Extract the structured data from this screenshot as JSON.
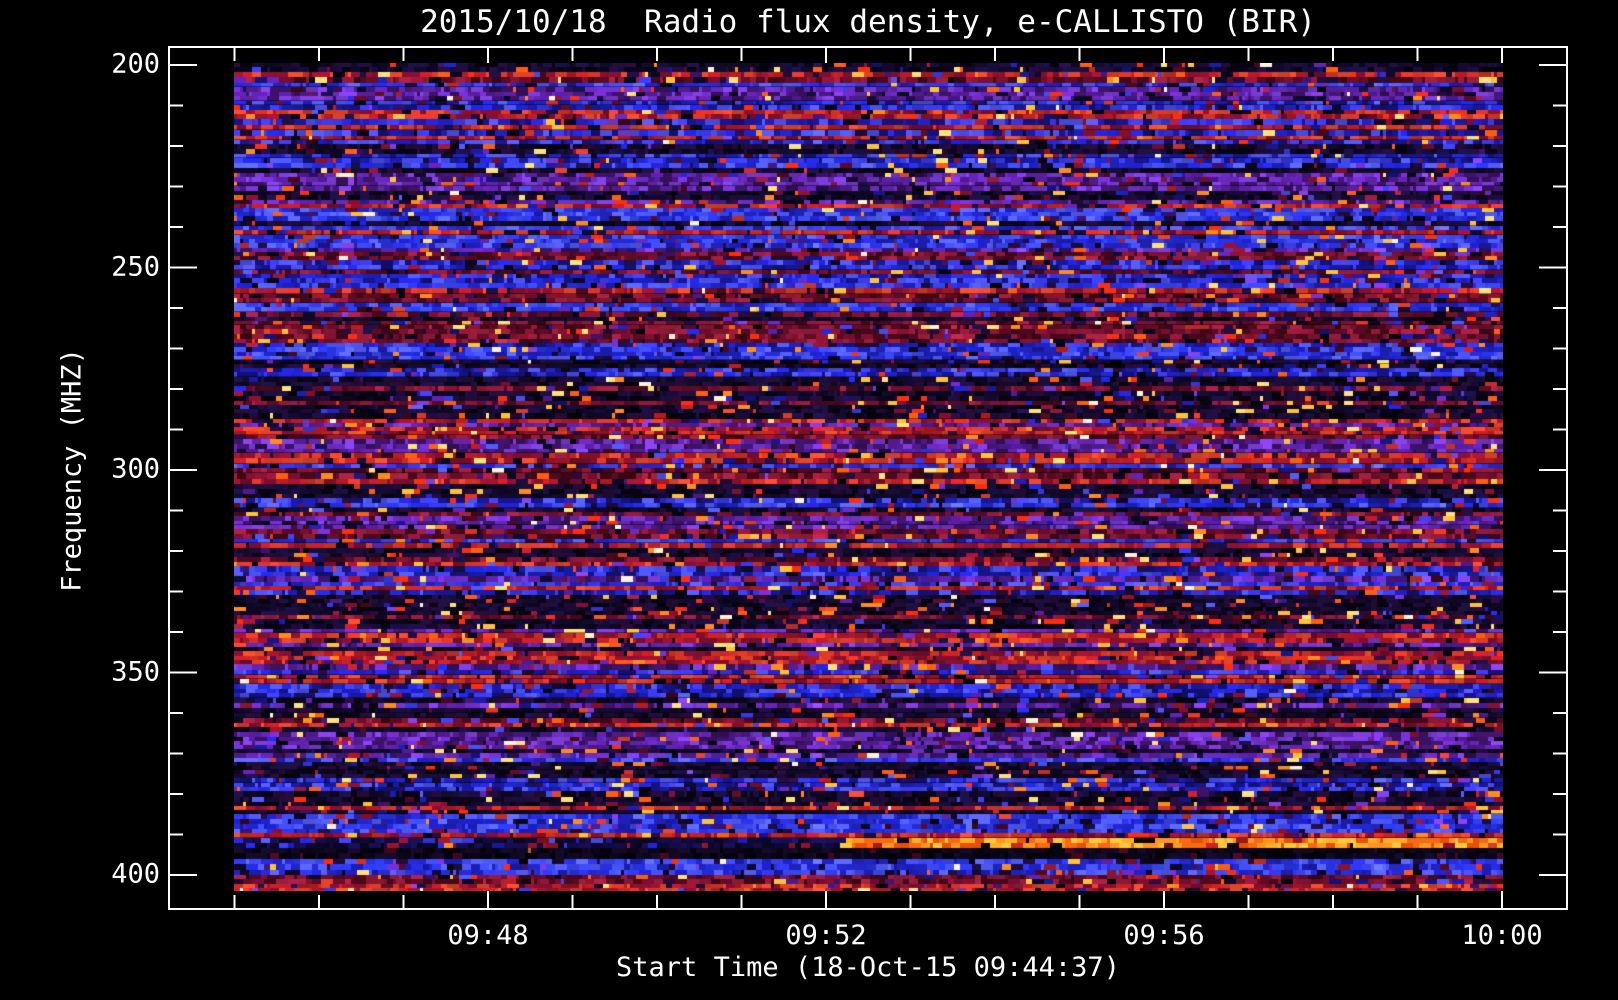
{
  "title": "2015/10/18  Radio flux density, e-CALLISTO (BIR)",
  "axes": {
    "x": {
      "title": "Start Time (18-Oct-15 09:44:37)",
      "major_tick_labels": [
        "09:48",
        "09:52",
        "09:56",
        "10:00"
      ],
      "minor_tick_interval": "1 min"
    },
    "y": {
      "title": "Frequency (MHZ)",
      "major_tick_labels": [
        "200",
        "250",
        "300",
        "350",
        "400"
      ],
      "minor_tick_interval": "10 MHz"
    }
  },
  "chart_data": {
    "type": "heatmap",
    "title": "2015/10/18  Radio flux density, e-CALLISTO (BIR)",
    "xlabel": "Start Time (18-Oct-15 09:44:37)",
    "ylabel": "Frequency (MHZ)",
    "x_ticks": [
      "09:48",
      "09:52",
      "09:56",
      "10:00"
    ],
    "x_range": [
      "09:45:00",
      "10:00:00"
    ],
    "y_ticks": [
      200,
      250,
      300,
      350,
      400
    ],
    "y_range_mhz": [
      199,
      404
    ],
    "y_axis_inverted": true,
    "grid": false,
    "legend": false,
    "content_description": "Dense broadband noise spectrogram: horizontal frequency-channel bands alternating bright blue, purple, red, maroon and near-black, with sparse orange/yellow speckles and vertical striations",
    "features": [
      {
        "name": "quiet-dark-channel",
        "freq_mhz": 392,
        "time_span": [
          "09:45",
          "09:52"
        ],
        "appearance": "dark navy/black horizontal band"
      },
      {
        "name": "rfi-carrier",
        "freq_mhz": 392,
        "time_span": [
          "09:52",
          "10:00"
        ],
        "appearance": "bright orange-yellow horizontal line switching on near 09:52"
      },
      {
        "name": "black-channel",
        "freq_mhz": 395,
        "time_span": [
          "09:45",
          "10:00"
        ],
        "appearance": "near-black horizontal band across full width"
      }
    ],
    "palette": {
      "background": "#000000",
      "axis_and_text": "#ffffff",
      "blue": [
        "#2126d8",
        "#3a3cf0",
        "#1a1aa8",
        "#4d55f5",
        "#14127a"
      ],
      "bright_blue": [
        "#2b35f0",
        "#3f4cff",
        "#2226c8",
        "#5560ff",
        "#1c1eb8"
      ],
      "purple": [
        "#5c1fa6",
        "#47177c",
        "#6f2cc4",
        "#38115e",
        "#7a3cd4"
      ],
      "red": [
        "#bd1c24",
        "#98122c",
        "#d43426",
        "#7c0f2e",
        "#e0452a"
      ],
      "maroon": [
        "#6f0e2e",
        "#530a20",
        "#8c1636",
        "#400818",
        "#9a1f3e"
      ],
      "dark": [
        "#07030f",
        "#120a2c",
        "#1b1042",
        "#240c38",
        "#0d0620"
      ],
      "speckle": [
        "#ff8c1c",
        "#ffc33a",
        "#ff5e10",
        "#ffe27a",
        "#ff2e0e"
      ],
      "carrier": [
        "#ff9522",
        "#ffc83e",
        "#f56a12",
        "#ffb028",
        "#e85008"
      ],
      "dark_navy_channel": [
        "#0a0620",
        "#10083a",
        "#160e4e"
      ],
      "black_channel": [
        "#05020c",
        "#0b0618",
        "#140a26"
      ]
    }
  }
}
